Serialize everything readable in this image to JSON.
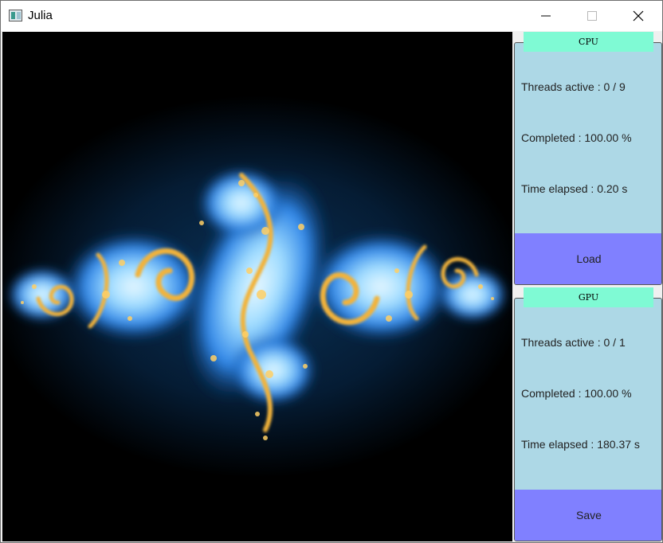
{
  "window": {
    "title": "Julia"
  },
  "cpu": {
    "label": "CPU",
    "threads_active": "Threads active : 0 / 9",
    "completed": "Completed : 100.00 %",
    "time_elapsed": "Time elapsed : 0.20 s",
    "button_label": "Load"
  },
  "gpu": {
    "label": "GPU",
    "threads_active": "Threads active : 0 / 1",
    "completed": "Completed : 100.00 %",
    "time_elapsed": "Time elapsed : 180.37 s",
    "button_label": "Save"
  },
  "colors": {
    "panel_background": "#add8e6",
    "panel_tab": "#7ffad4",
    "panel_button": "#8080ff",
    "fractal_background": "#000000",
    "fractal_glow": "#3aa0ff",
    "fractal_detail": "#f0a020"
  },
  "icons": {
    "app": "julia-app-icon",
    "minimize": "minimize-icon",
    "maximize": "maximize-icon",
    "close": "close-icon"
  }
}
